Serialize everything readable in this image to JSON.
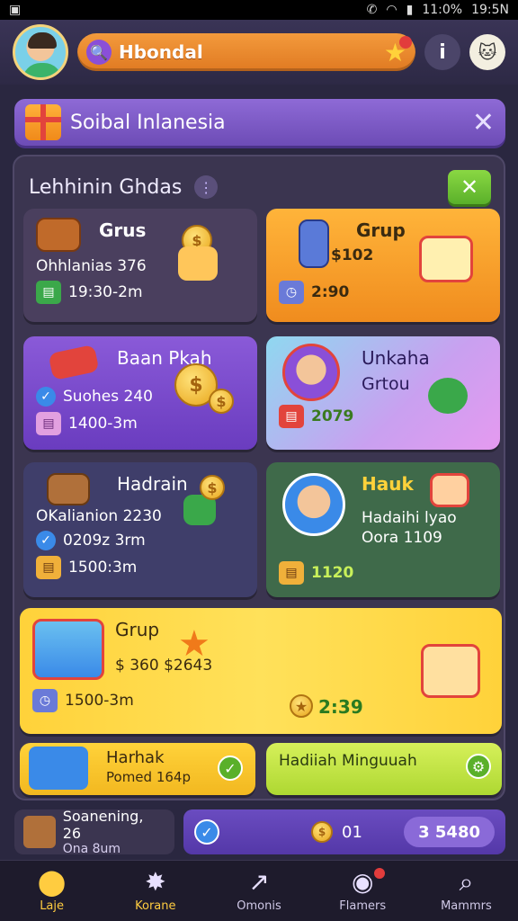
{
  "status_bar": {
    "signal": "✉",
    "battery": "11:0%",
    "time": "19:5N"
  },
  "topbar": {
    "player_name": "Hbondal",
    "info_label": "i"
  },
  "banner": {
    "title": "Soibal Inlanesia",
    "close_label": "✕"
  },
  "panel": {
    "title": "Lehhinin Ghdas",
    "dots_label": "⋮",
    "close_label": "✕",
    "cards": [
      {
        "title": "Grus",
        "line1": "Ohhlanias 376",
        "line2": "19:30-2m"
      },
      {
        "title": "Grup",
        "line1": "$102",
        "line2": "2:90"
      },
      {
        "title": "Baan Pkah",
        "line1": "Suohes 240",
        "line2": "1400-3m"
      },
      {
        "title": "Unkaha",
        "line1": "Grtou",
        "line2": "2079"
      },
      {
        "title": "Hadrain",
        "line1": "OKalianion 2230",
        "line2": "0209z 3rm",
        "line3": "1500:3m"
      },
      {
        "title": "Hauk",
        "line1": "Hadaihi lyao",
        "line2": "Oora 1109",
        "line3": "1120"
      },
      {
        "title": "Grup",
        "line1": "$ 360 $2643",
        "line2": "1500-3m",
        "line3": "2:39"
      },
      {
        "title": "Harhak",
        "line1": "Pomed 164p"
      },
      {
        "title": "Hadiiah Minguuah"
      }
    ]
  },
  "bottom_row": {
    "left_title": "Soanening, 26",
    "left_sub": "Ona 8um",
    "right_value": "01",
    "right_pill": "3 5480"
  },
  "nav": [
    {
      "label": "Laje",
      "icon": "location-pin-icon"
    },
    {
      "label": "Korane",
      "icon": "star-badge-icon"
    },
    {
      "label": "Omonis",
      "icon": "chart-icon"
    },
    {
      "label": "Flamers",
      "icon": "chat-icon"
    },
    {
      "label": "Mammrs",
      "icon": "search-icon"
    }
  ],
  "colors": {
    "accent_orange": "#f39a3c",
    "accent_purple": "#6d4cb6",
    "accent_green": "#5ab02a",
    "accent_yellow": "#ffd23a"
  }
}
